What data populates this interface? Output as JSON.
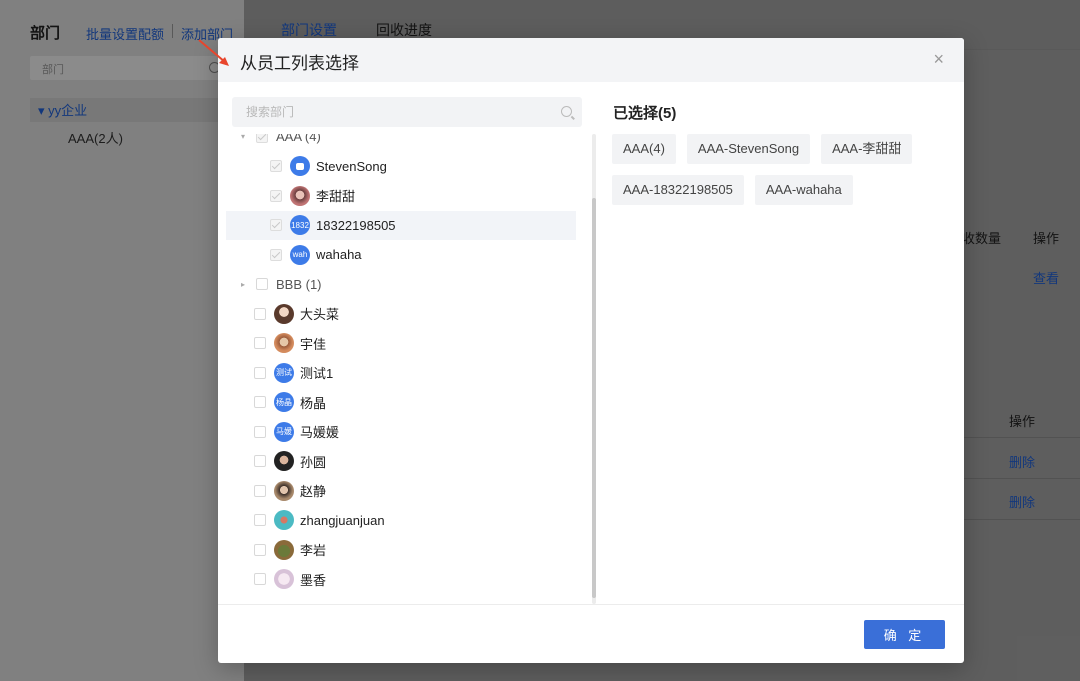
{
  "background": {
    "sidebar_title": "部门",
    "batch_link": "批量设置配额",
    "add_link": "添加部门",
    "search_placeholder": "部门",
    "tree_root": "yy企业",
    "tree_child": "AAA(2人)",
    "tab_dept": "部门设置",
    "tab_recycle": "回收进度",
    "col_count": "收数量",
    "col_action": "操作",
    "view_link": "查看",
    "col_action2": "操作",
    "delete_1": "删除",
    "delete_2": "删除"
  },
  "modal": {
    "title": "从员工列表选择",
    "close": "×",
    "search_placeholder": "搜索部门",
    "tree": [
      {
        "kind": "group",
        "label": "AAA (4)",
        "checked": true,
        "expanded": true
      },
      {
        "kind": "user",
        "label": "StevenSong",
        "checked": true,
        "avatar": "robot"
      },
      {
        "kind": "user",
        "label": "李甜甜",
        "checked": true,
        "avatar": "photo"
      },
      {
        "kind": "user",
        "label": "18322198505",
        "checked": true,
        "avatar_text": "1832"
      },
      {
        "kind": "user",
        "label": "wahaha",
        "checked": true,
        "avatar_text": "wah"
      },
      {
        "kind": "group",
        "label": "BBB (1)",
        "checked": false,
        "expanded": false
      },
      {
        "kind": "user",
        "label": "大头菜",
        "checked": false,
        "avatar": "photo"
      },
      {
        "kind": "user",
        "label": "宇佳",
        "checked": false,
        "avatar": "photo"
      },
      {
        "kind": "user",
        "label": "测试1",
        "checked": false,
        "avatar_text": "测试"
      },
      {
        "kind": "user",
        "label": "杨晶",
        "checked": false,
        "avatar_text": "杨晶"
      },
      {
        "kind": "user",
        "label": "马媛媛",
        "checked": false,
        "avatar_text": "马媛"
      },
      {
        "kind": "user",
        "label": "孙圆",
        "checked": false,
        "avatar": "photo"
      },
      {
        "kind": "user",
        "label": "赵静",
        "checked": false,
        "avatar": "photo"
      },
      {
        "kind": "user",
        "label": "zhangjuanjuan",
        "checked": false,
        "avatar": "photo"
      },
      {
        "kind": "user",
        "label": "李岩",
        "checked": false,
        "avatar": "photo"
      },
      {
        "kind": "user",
        "label": "墨香",
        "checked": false,
        "avatar": "photo"
      }
    ],
    "selected_title": "已选择(5)",
    "selected": [
      "AAA(4)",
      "AAA-StevenSong",
      "AAA-李甜甜",
      "AAA-18322198505",
      "AAA-wahaha"
    ],
    "confirm": "确 定"
  },
  "colors": {
    "accent": "#3a6fd8",
    "link": "#1f5fd6",
    "annotation_arrow": "#e8452c"
  }
}
